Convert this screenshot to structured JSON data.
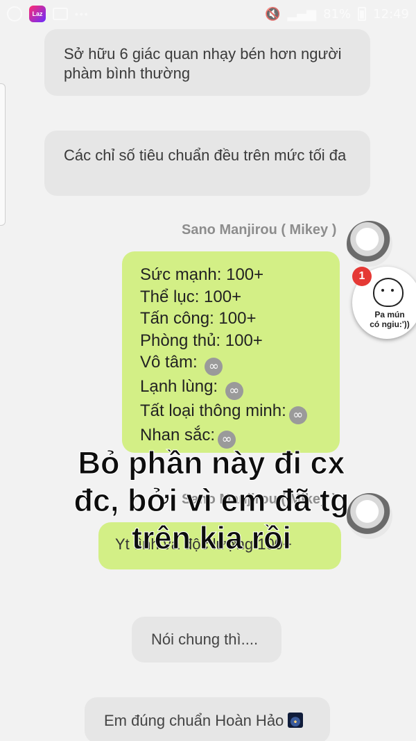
{
  "status_bar": {
    "battery": "81%",
    "time": "12:49",
    "app_badge": "Laz"
  },
  "messages": {
    "msg1": "Sở hữu 6 giác quan nhạy bén hơn người phàm bình thường",
    "msg2": "Các chỉ số tiêu chuẩn đều trên mức tối đa",
    "sender1": "Sano Manjirou ( Mikey )",
    "stats": [
      {
        "label": "Sức mạnh: 100+"
      },
      {
        "label": "Thể lục: 100+"
      },
      {
        "label": "Tấn công: 100+"
      },
      {
        "label": "Phòng thủ: 100+"
      },
      {
        "label": "Vô tâm: "
      },
      {
        "label": "Lạnh lùng: "
      },
      {
        "label": "Tất loại thông minh:"
      },
      {
        "label": "Nhan sắc:"
      }
    ],
    "infinity_symbol": "∞",
    "sender2": "Sano Manjirou ( Mikey )",
    "msg_yt": "Yt tình và độc lượng 100+",
    "msg_noi": "Nói chung thì....",
    "msg_em": "Em đúng chuẩn Hoàn Hảo"
  },
  "chathead": {
    "badge_count": "1",
    "text": "Pa mún có ngiu:'))"
  },
  "overlay_caption": "Bỏ phần này đi cx đc, bởi vì em đã tg trên kia rồi"
}
